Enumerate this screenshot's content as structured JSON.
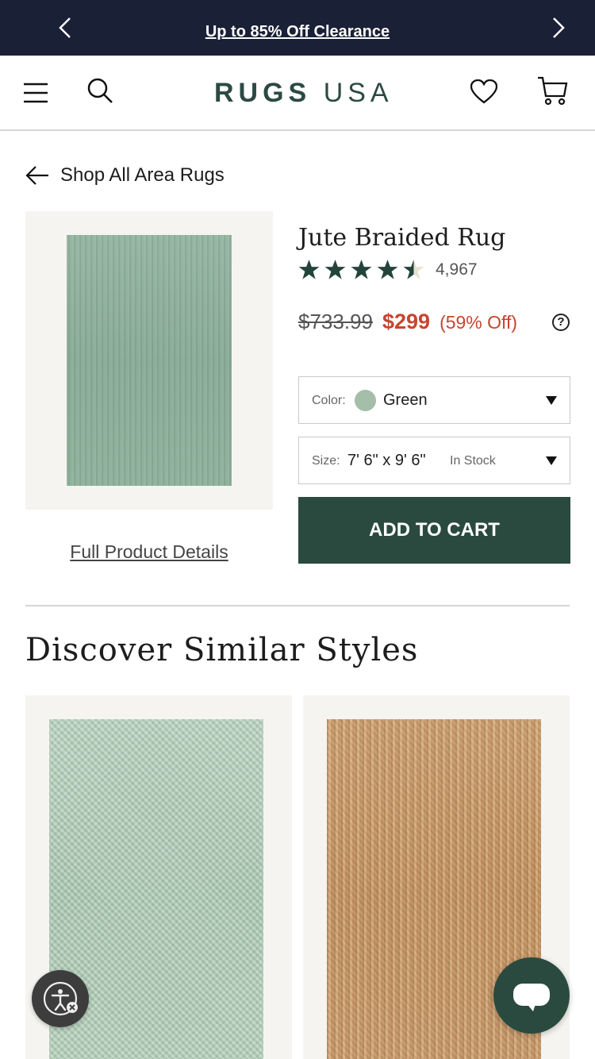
{
  "promo": {
    "text": "Up to 85% Off Clearance",
    "prev_icon": "chevron-left-icon",
    "next_icon": "chevron-right-icon"
  },
  "header": {
    "logo_bold": "RUGS",
    "logo_light": "USA",
    "icons": [
      "menu-icon",
      "search-icon",
      "heart-icon",
      "cart-icon"
    ]
  },
  "back_link": {
    "label": "Shop All Area Rugs",
    "icon": "arrow-left-icon"
  },
  "product": {
    "title": "Jute Braided Rug",
    "rating": 4.5,
    "review_count": "4,967",
    "old_price": "$733.99",
    "new_price": "$299",
    "discount": "(59% Off)",
    "help_symbol": "?",
    "full_details_link": "Full Product Details",
    "color_select": {
      "label": "Color:",
      "value": "Green",
      "swatch_color": "#a4bea9"
    },
    "size_select": {
      "label": "Size:",
      "value": "7' 6\" x 9' 6\"",
      "stock": "In Stock"
    },
    "add_to_cart": "ADD TO CART"
  },
  "similar": {
    "title": "Discover Similar Styles"
  },
  "colors": {
    "banner_bg": "#1a2036",
    "brand_green": "#2a4a3f",
    "sale_red": "#c6452e",
    "star_green": "#24443b"
  }
}
